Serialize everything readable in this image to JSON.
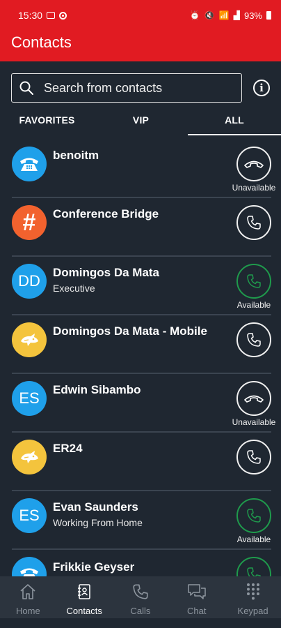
{
  "status_bar": {
    "time": "15:30",
    "icons": [
      "image-icon",
      "record-icon",
      "alarm-icon",
      "mute-icon",
      "wifi-icon",
      "signal-icon",
      "battery-icon"
    ],
    "battery": "93%"
  },
  "app_bar": {
    "title": "Contacts"
  },
  "search": {
    "placeholder": "Search from contacts",
    "value": ""
  },
  "tabs": [
    {
      "label": "FAVORITES",
      "active": false
    },
    {
      "label": "VIP",
      "active": false
    },
    {
      "label": "ALL",
      "active": true
    }
  ],
  "contacts": [
    {
      "name": "benoitm",
      "status": "",
      "avatar_type": "phone",
      "avatar_color": "#1fa0ea",
      "presence": "Unavailable",
      "call_icon": "hangup"
    },
    {
      "name": "Conference Bridge",
      "status": "",
      "avatar_type": "hash",
      "avatar_color": "#f2622e",
      "presence": "",
      "call_icon": "phone"
    },
    {
      "name": "Domingos Da Mata",
      "status": "Executive",
      "avatar_type": "initials",
      "initials": "DD",
      "avatar_color": "#1fa0ea",
      "presence": "Available",
      "call_icon": "phone-green"
    },
    {
      "name": "Domingos Da Mata - Mobile",
      "status": "",
      "avatar_type": "mascot",
      "avatar_color": "#f4c43d",
      "presence": "",
      "call_icon": "phone"
    },
    {
      "name": "Edwin Sibambo",
      "status": "",
      "avatar_type": "initials",
      "initials": "ES",
      "avatar_color": "#1fa0ea",
      "presence": "Unavailable",
      "call_icon": "hangup"
    },
    {
      "name": "ER24",
      "status": "",
      "avatar_type": "mascot",
      "avatar_color": "#f4c43d",
      "presence": "",
      "call_icon": "phone"
    },
    {
      "name": "Evan Saunders",
      "status": "Working From Home",
      "avatar_type": "initials",
      "initials": "ES",
      "avatar_color": "#1fa0ea",
      "presence": "Available",
      "call_icon": "phone-green"
    },
    {
      "name": "Frikkie Geyser",
      "status": "",
      "avatar_type": "phone",
      "avatar_color": "#1fa0ea",
      "presence": "",
      "call_icon": "phone-green"
    }
  ],
  "bottom_nav": [
    {
      "label": "Home",
      "icon": "home-icon",
      "active": false
    },
    {
      "label": "Contacts",
      "icon": "contacts-book-icon",
      "active": true
    },
    {
      "label": "Calls",
      "icon": "phone-icon",
      "active": false
    },
    {
      "label": "Chat",
      "icon": "chat-icon",
      "active": false
    },
    {
      "label": "Keypad",
      "icon": "keypad-icon",
      "active": false
    }
  ],
  "colors": {
    "brand_red": "#e11b22",
    "background": "#1f2731",
    "available_green": "#1f9a4c",
    "avatar_blue": "#1fa0ea",
    "avatar_orange": "#f2622e",
    "avatar_yellow": "#f4c43d"
  }
}
